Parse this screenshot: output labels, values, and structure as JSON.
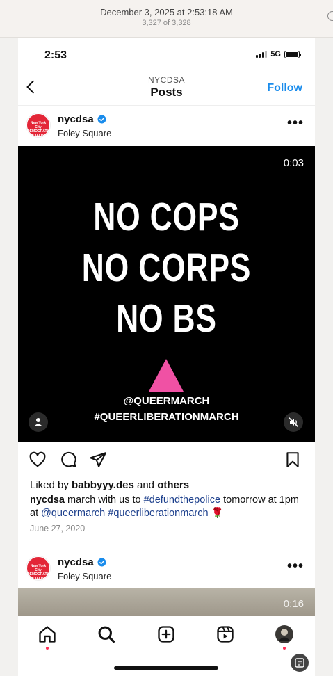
{
  "viewer": {
    "date": "December 3, 2025 at 2:53:18 AM",
    "count": "3,327 of 3,328"
  },
  "status": {
    "time": "2:53",
    "network": "5G"
  },
  "nav": {
    "account": "NYCDSA",
    "title": "Posts",
    "follow": "Follow"
  },
  "post1": {
    "username": "nycdsa",
    "location": "Foley Square",
    "logo_text": "New York City DEMOCRATIC SOCIALISTS of America",
    "timer": "0:03",
    "slogan": [
      "NO COPS",
      "NO CORPS",
      "NO BS"
    ],
    "handle": "@QUEERMARCH",
    "hashtag": "#QUEERLIBERATIONMARCH",
    "liked_by_prefix": "Liked by ",
    "liked_by_user": "babbyyy.des",
    "liked_by_mid": " and ",
    "liked_by_others": "others",
    "caption_user": "nycdsa",
    "caption_1": " march with us to ",
    "caption_tag1": "#defundthepolice",
    "caption_2": " tomorrow at 1pm at ",
    "caption_tag2": "@queermarch",
    "caption_3": " ",
    "caption_tag3": "#queerliberationmarch",
    "caption_emoji": " 🌹",
    "date": "June 27, 2020"
  },
  "post2": {
    "username": "nycdsa",
    "location": "Foley Square",
    "timer": "0:16"
  },
  "colors": {
    "accent": "#1a8cec",
    "brand": "#e32637",
    "triangle": "#f051a4",
    "notification": "#ff2d55"
  },
  "icons": [
    "back-icon",
    "verified-icon",
    "more-icon",
    "heart-icon",
    "comment-icon",
    "share-icon",
    "bookmark-icon",
    "person-icon",
    "mute-icon",
    "home-icon",
    "search-icon",
    "create-icon",
    "reels-icon",
    "profile-avatar"
  ]
}
